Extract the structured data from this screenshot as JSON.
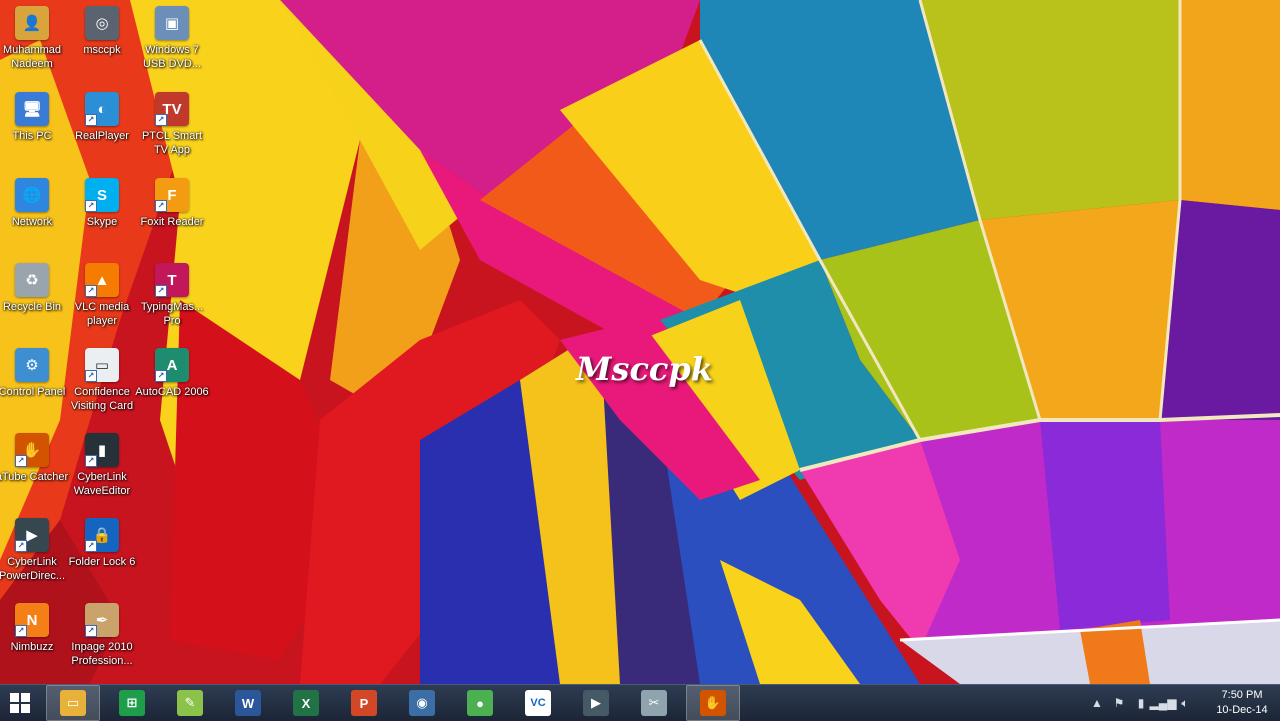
{
  "desktop": {
    "watermark": "Msccpk",
    "icons": [
      {
        "label": "Muhammad Nadeem",
        "icon": "user-folder-icon",
        "color": "#d9a43c"
      },
      {
        "label": "msccpk",
        "icon": "webcam-icon",
        "color": "#5a6470"
      },
      {
        "label": "Windows 7 USB DVD...",
        "icon": "usb-dvd-tool-icon",
        "color": "#6b8fb8"
      },
      {
        "label": "This PC",
        "icon": "computer-icon",
        "color": "#3a7bd5"
      },
      {
        "label": "RealPlayer",
        "icon": "realplayer-icon",
        "color": "#2b8fd6"
      },
      {
        "label": "PTCL Smart TV App",
        "icon": "ptcl-tv-icon",
        "color": "#c0392b"
      },
      {
        "label": "Network",
        "icon": "network-globe-icon",
        "color": "#2e86de"
      },
      {
        "label": "Skype",
        "icon": "skype-icon",
        "color": "#00aff0"
      },
      {
        "label": "Foxit Reader",
        "icon": "foxit-reader-icon",
        "color": "#f39c12"
      },
      {
        "label": "Recycle Bin",
        "icon": "recycle-bin-icon",
        "color": "#9aa4ad"
      },
      {
        "label": "VLC media player",
        "icon": "vlc-cone-icon",
        "color": "#f57c00"
      },
      {
        "label": "TypingMas... Pro",
        "icon": "typingmaster-icon",
        "color": "#c2185b"
      },
      {
        "label": "Control Panel",
        "icon": "control-panel-icon",
        "color": "#3d8fd1"
      },
      {
        "label": "Confidence Visiting Card",
        "icon": "visiting-card-icon",
        "color": "#eceff1"
      },
      {
        "label": "AutoCAD 2006",
        "icon": "autocad-icon",
        "color": "#1e8c6e"
      },
      {
        "label": "aTube Catcher",
        "icon": "atube-catcher-icon",
        "color": "#d35400"
      },
      {
        "label": "CyberLink WaveEditor",
        "icon": "cyberlink-waveeditor-icon",
        "color": "#263238"
      },
      {
        "label": "CyberLink PowerDirec...",
        "icon": "cyberlink-powerdirector-icon",
        "color": "#37474f"
      },
      {
        "label": "Folder Lock 6",
        "icon": "folder-lock-icon",
        "color": "#1565c0"
      },
      {
        "label": "Nimbuzz",
        "icon": "nimbuzz-icon",
        "color": "#f57f17"
      },
      {
        "label": "Inpage 2010 Profession...",
        "icon": "inpage-icon",
        "color": "#c9a36b"
      }
    ]
  },
  "taskbar": {
    "start_icon": "windows-start-icon",
    "pinned": [
      {
        "name": "file-explorer-icon",
        "color": "#e8b23a",
        "glyph": "▭",
        "active": true
      },
      {
        "name": "store-icon",
        "color": "#1e9e4a",
        "glyph": "⊞",
        "active": false
      },
      {
        "name": "green-app-icon",
        "color": "#8bc34a",
        "glyph": "✎",
        "active": false
      },
      {
        "name": "word-icon",
        "color": "#2b579a",
        "glyph": "W",
        "active": false
      },
      {
        "name": "excel-icon",
        "color": "#217346",
        "glyph": "X",
        "active": false
      },
      {
        "name": "powerpoint-icon",
        "color": "#d24726",
        "glyph": "P",
        "active": false
      },
      {
        "name": "media-player-icon",
        "color": "#3a6ea5",
        "glyph": "◉",
        "active": false
      },
      {
        "name": "chrome-icon",
        "color": "#4caf50",
        "glyph": "●",
        "active": false
      },
      {
        "name": "vc-app-icon",
        "color": "#ffffff",
        "glyph": "VC",
        "active": false
      },
      {
        "name": "presentation-icon",
        "color": "#455a64",
        "glyph": "▶",
        "active": false
      },
      {
        "name": "snipping-tool-icon",
        "color": "#90a4ae",
        "glyph": "✂",
        "active": false
      },
      {
        "name": "atube-taskbar-icon",
        "color": "#d35400",
        "glyph": "✋",
        "active": true
      }
    ],
    "tray": {
      "icons": [
        "show-hidden-icons-icon",
        "action-center-flag-icon",
        "power-icon",
        "network-signal-icon",
        "volume-icon"
      ],
      "time": "7:50 PM",
      "date": "10-Dec-14"
    }
  }
}
